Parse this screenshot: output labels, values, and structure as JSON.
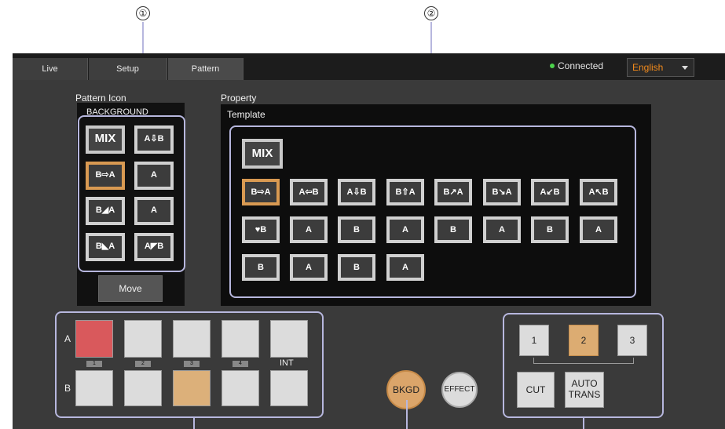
{
  "callouts": {
    "one": "①",
    "two": "②"
  },
  "tabs": [
    {
      "label": "Live"
    },
    {
      "label": "Setup"
    },
    {
      "label": "Pattern"
    }
  ],
  "status": {
    "connected": "Connected"
  },
  "language": {
    "selected": "English"
  },
  "pattern_icon": {
    "title": "Pattern Icon",
    "subtitle": "BACKGROUND",
    "icons": [
      "MIX",
      "A⇩B",
      "B⇨A",
      "A",
      "B◢A",
      "A",
      "B◣A",
      "A◤B"
    ],
    "move_label": "Move"
  },
  "property": {
    "title": "Property",
    "template_label": "Template",
    "mix": "MIX",
    "row1": [
      "B⇨A",
      "A⇦B",
      "A⇩B",
      "B⇧A",
      "B↗A",
      "B↘A",
      "A↙B",
      "A↖B"
    ],
    "row2": [
      "♥B",
      "A",
      "B",
      "A",
      "B",
      "A",
      "B",
      "A"
    ],
    "row3": [
      "B",
      "A",
      "B",
      "A"
    ]
  },
  "crosspoint": {
    "row_a": "A",
    "row_b": "B",
    "tags": [
      "1",
      "2",
      "3",
      "4"
    ],
    "int_label": "INT"
  },
  "bkgd": {
    "label": "BKGD"
  },
  "effect": {
    "label": "EFFECT"
  },
  "transition": {
    "buttons": [
      "1",
      "2",
      "3"
    ],
    "cut": "CUT",
    "auto_trans": "AUTO\nTRANS"
  },
  "colors": {
    "accent_orange": "#d9a86c",
    "red": "#d9595c",
    "highlight": "#b7b7de",
    "connected_green": "#4cd24c",
    "language_text": "#f28a1b"
  }
}
